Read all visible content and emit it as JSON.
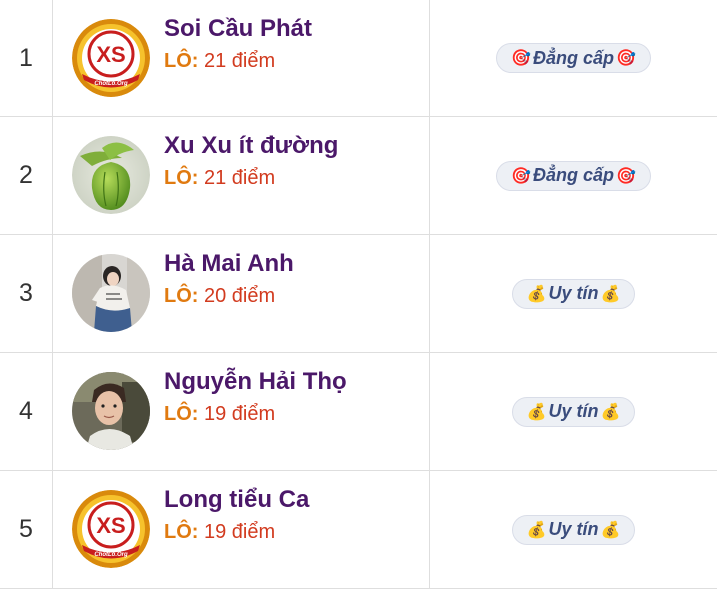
{
  "rows": [
    {
      "rank": "1",
      "name": "Soi Cầu Phát",
      "score_label": "LÔ:",
      "score_text": "21 điểm",
      "badge": "Đẳng cấp",
      "badge_icon": "🎯",
      "avatar_type": "logo",
      "avatar_logo_text": "XS",
      "avatar_logo_sub": "ChotLo.Org"
    },
    {
      "rank": "2",
      "name": "Xu Xu ít đường",
      "score_label": "LÔ:",
      "score_text": "21 điểm",
      "badge": "Đẳng cấp",
      "badge_icon": "🎯",
      "avatar_type": "photo-chayote"
    },
    {
      "rank": "3",
      "name": "Hà Mai Anh",
      "score_label": "LÔ:",
      "score_text": "20 điểm",
      "badge": "Uy tín",
      "badge_icon": "💰",
      "avatar_type": "photo-girl"
    },
    {
      "rank": "4",
      "name": "Nguyễn Hải Thọ",
      "score_label": "LÔ:",
      "score_text": "19 điểm",
      "badge": "Uy tín",
      "badge_icon": "💰",
      "avatar_type": "photo-selfie"
    },
    {
      "rank": "5",
      "name": "Long tiểu Ca",
      "score_label": "LÔ:",
      "score_text": "19 điểm",
      "badge": "Uy tín",
      "badge_icon": "💰",
      "avatar_type": "logo",
      "avatar_logo_text": "XS",
      "avatar_logo_sub": "ChotLo.Org"
    }
  ],
  "colors": {
    "name": "#4b1869",
    "score_label": "#e07a10",
    "score_value": "#d23b1f",
    "badge_bg": "#edf0f5",
    "badge_text": "#3a4c7c",
    "border": "#dedede"
  }
}
